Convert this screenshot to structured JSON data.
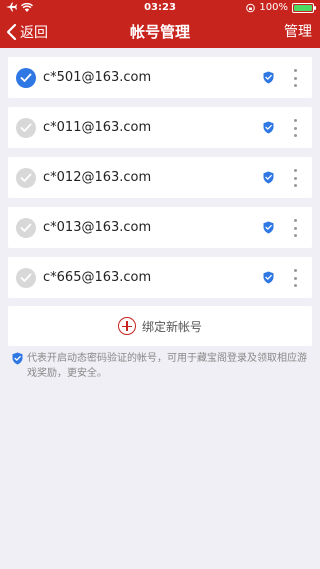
{
  "status_bar": {
    "time": "03:23",
    "battery": "100%",
    "battery_level": 1.0
  },
  "nav": {
    "back_label": "返回",
    "title": "帐号管理",
    "manage_label": "管理"
  },
  "accounts": [
    {
      "email": "c*501@163.com",
      "selected": true
    },
    {
      "email": "c*011@163.com",
      "selected": false
    },
    {
      "email": "c*012@163.com",
      "selected": false
    },
    {
      "email": "c*013@163.com",
      "selected": false
    },
    {
      "email": "c*665@163.com",
      "selected": false
    }
  ],
  "bind_button": {
    "label": "绑定新帐号"
  },
  "note": {
    "text": "代表开启动态密码验证的帐号，可用于藏宝阁登录及领取相应游戏奖励，更安全。"
  },
  "colors": {
    "brand": "#c8241e",
    "selected": "#2f78e4",
    "shield": "#2f78e4"
  },
  "icons": {
    "back": "chevron-left-icon",
    "shield": "shield-check-icon",
    "more": "more-vertical-icon",
    "add": "plus-circle-icon"
  }
}
